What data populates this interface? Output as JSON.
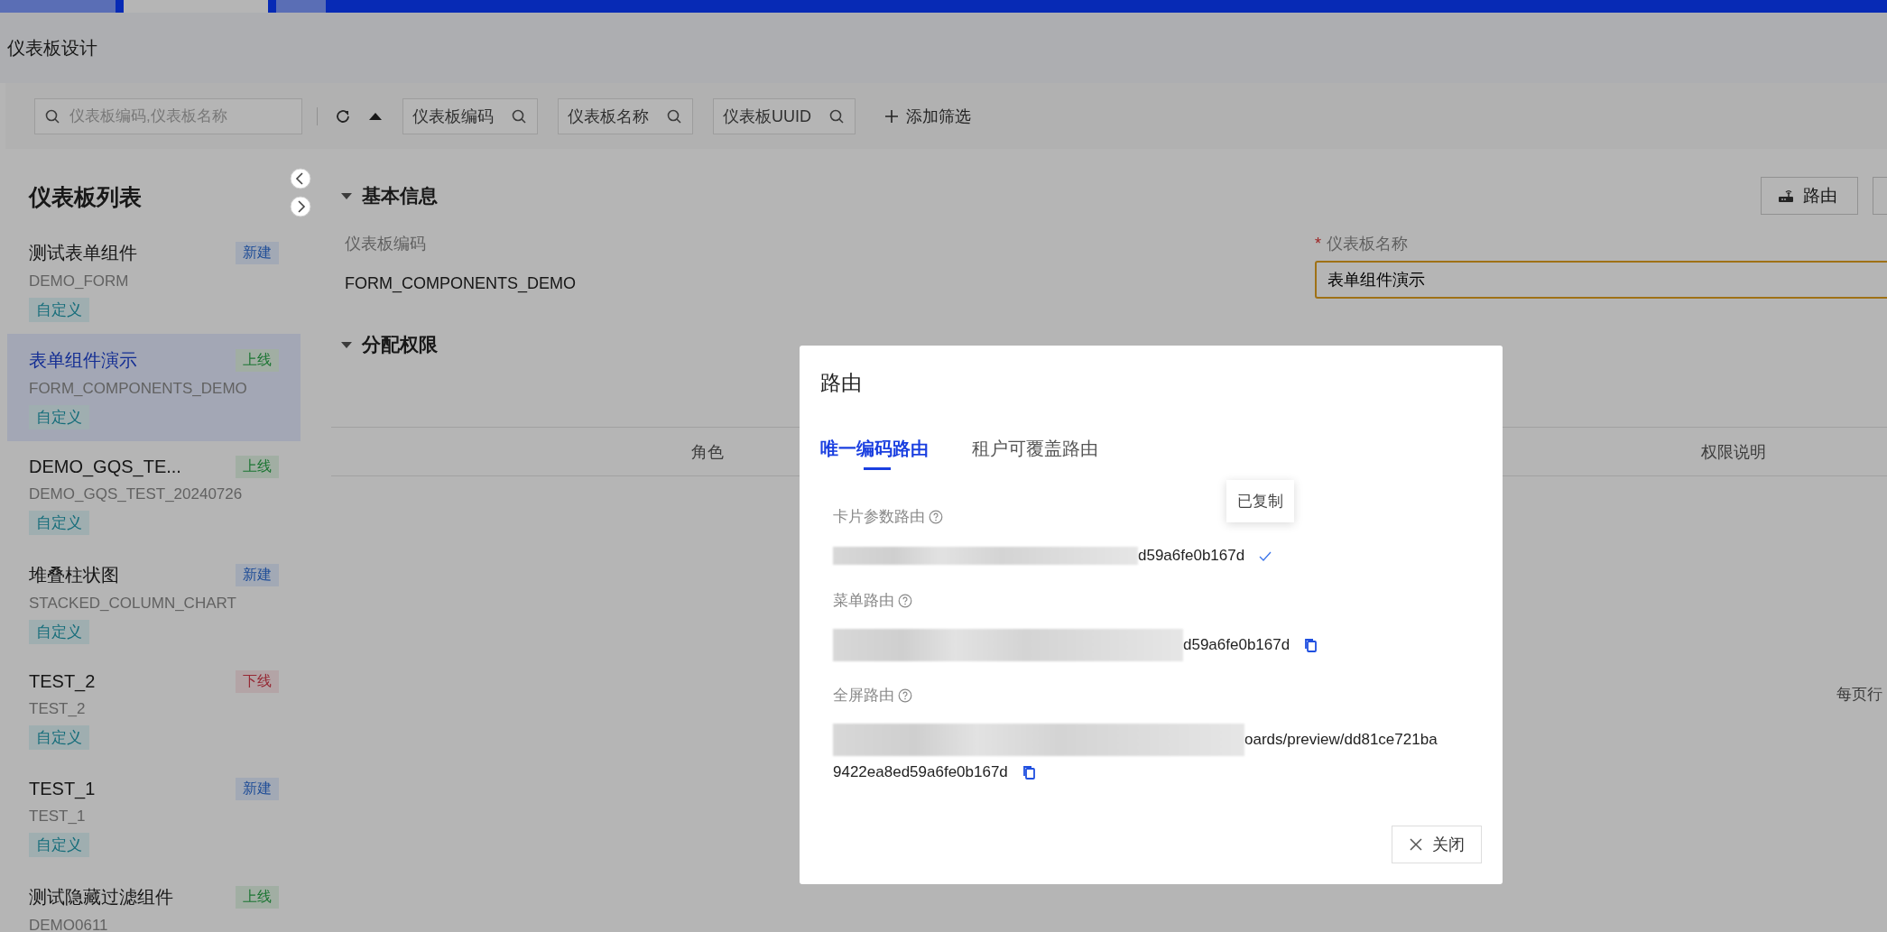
{
  "top_tabs": [
    {
      "selected": false
    },
    {
      "selected": true
    },
    {
      "selected": false
    }
  ],
  "page_title": "仪表板设计",
  "filter_bar": {
    "search": {
      "placeholder": "仪表板编码,仪表板名称"
    },
    "filters": [
      "仪表板编码",
      "仪表板名称",
      "仪表板UUID"
    ],
    "add_filter": "添加筛选"
  },
  "sidebar": {
    "title": "仪表板列表",
    "items": [
      {
        "name": "测试表单组件",
        "code": "DEMO_FORM",
        "status": {
          "kind": "new",
          "label": "新建"
        },
        "tag": "自定义",
        "selected": false
      },
      {
        "name": "表单组件演示",
        "code": "FORM_COMPONENTS_DEMO",
        "status": {
          "kind": "online",
          "label": "上线"
        },
        "tag": "自定义",
        "selected": true
      },
      {
        "name": "DEMO_GQS_TE...",
        "code": "DEMO_GQS_TEST_20240726",
        "status": {
          "kind": "online",
          "label": "上线"
        },
        "tag": "自定义",
        "selected": false
      },
      {
        "name": "堆叠柱状图",
        "code": "STACKED_COLUMN_CHART",
        "status": {
          "kind": "new",
          "label": "新建"
        },
        "tag": "自定义",
        "selected": false
      },
      {
        "name": "TEST_2",
        "code": "TEST_2",
        "status": {
          "kind": "offline",
          "label": "下线"
        },
        "tag": "自定义",
        "selected": false
      },
      {
        "name": "TEST_1",
        "code": "TEST_1",
        "status": {
          "kind": "new",
          "label": "新建"
        },
        "tag": "自定义",
        "selected": false
      },
      {
        "name": "测试隐藏过滤组件",
        "code": "DEMO0611",
        "status": {
          "kind": "online",
          "label": "上线"
        },
        "selected": false
      }
    ]
  },
  "toolbar": {
    "buttons": [
      {
        "kind": "route",
        "label": "路由"
      },
      {
        "kind": "more"
      }
    ]
  },
  "basic_info": {
    "title": "基本信息",
    "expanded": true,
    "fields": [
      {
        "kind": "text",
        "label": "仪表板编码",
        "value": "FORM_COMPONENTS_DEMO"
      },
      {
        "kind": "input",
        "label": "仪表板名称",
        "required_mark": "*",
        "value": "表单组件演示"
      }
    ]
  },
  "permissions": {
    "title": "分配权限",
    "expanded": true,
    "columns": [
      "角色",
      "权限说明"
    ]
  },
  "pagination": {
    "label": "每页行"
  },
  "modal": {
    "title": "路由",
    "tabs": [
      {
        "label": "唯一编码路由",
        "selected": true
      },
      {
        "label": "租户可覆盖路由",
        "selected": false
      }
    ],
    "routes": [
      {
        "label": "卡片参数路由",
        "lines": [
          "d59a6fe0b167d"
        ],
        "redacted": true,
        "copied": true,
        "tooltip": "已复制"
      },
      {
        "label": "菜单路由",
        "lines": [
          "d59a6fe0b167d"
        ],
        "redacted": true,
        "copied": false
      },
      {
        "label": "全屏路由",
        "lines": [
          "oards/preview/dd81ce721ba",
          "9422ea8ed59a6fe0b167d"
        ],
        "redacted": true,
        "copied": false
      }
    ],
    "close_button": "关闭"
  }
}
